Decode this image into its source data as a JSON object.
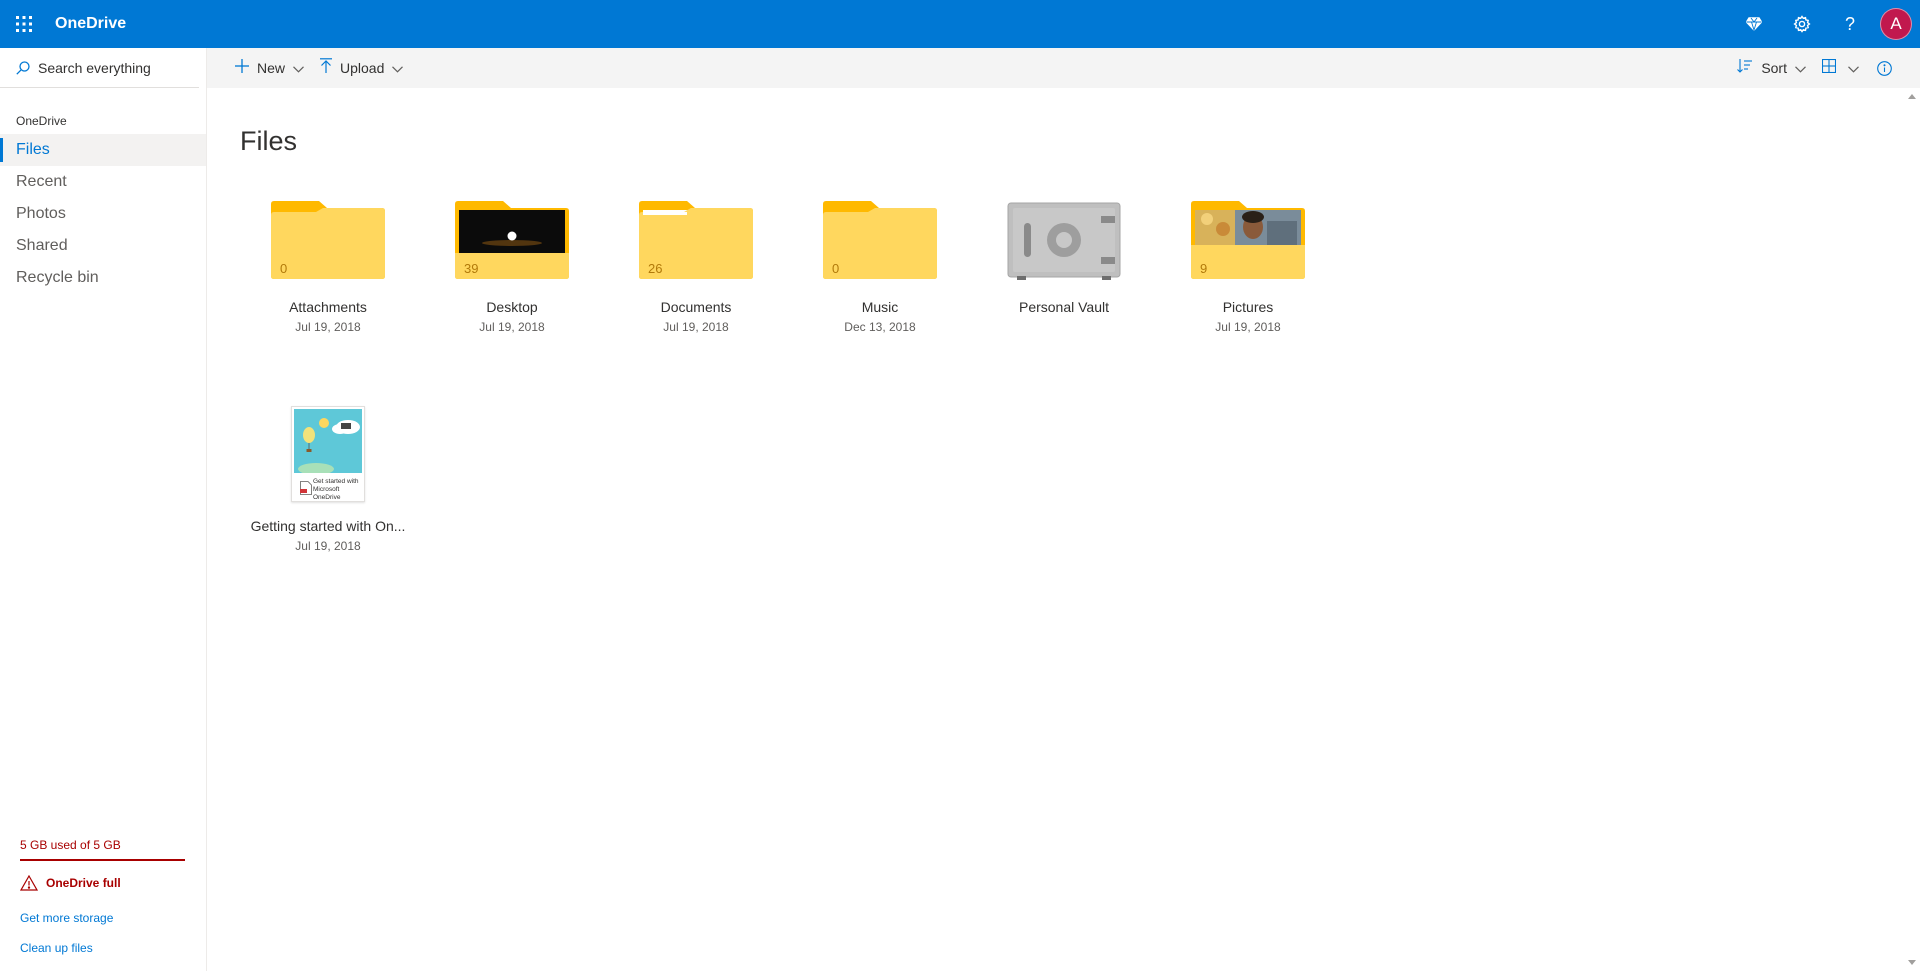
{
  "app": {
    "title": "OneDrive",
    "avatar_initial": "A",
    "accent": "#0078d4",
    "avatar_color": "#c1184e"
  },
  "topbar": {
    "icons": [
      "app-launcher-icon",
      "premium-diamond-icon",
      "settings-gear-icon",
      "help-icon"
    ]
  },
  "search": {
    "placeholder": "Search everything"
  },
  "sidebar": {
    "section": "OneDrive",
    "items": [
      {
        "label": "Files",
        "active": true
      },
      {
        "label": "Recent"
      },
      {
        "label": "Photos"
      },
      {
        "label": "Shared"
      },
      {
        "label": "Recycle bin"
      }
    ],
    "storage": {
      "usage_text": "5 GB used of 5 GB",
      "usage_fraction": 1.0,
      "full_label": "OneDrive full",
      "get_more": "Get more storage",
      "clean_up": "Clean up files"
    }
  },
  "commands": {
    "new": "New",
    "upload": "Upload",
    "sort": "Sort"
  },
  "main": {
    "title": "Files",
    "items": [
      {
        "name": "Attachments",
        "date": "Jul 19, 2018",
        "count": "0",
        "kind": "folder"
      },
      {
        "name": "Desktop",
        "date": "Jul 19, 2018",
        "count": "39",
        "kind": "folder-image"
      },
      {
        "name": "Documents",
        "date": "Jul 19, 2018",
        "count": "26",
        "kind": "folder"
      },
      {
        "name": "Music",
        "date": "Dec 13, 2018",
        "count": "0",
        "kind": "folder"
      },
      {
        "name": "Personal Vault",
        "date": "",
        "count": "",
        "kind": "vault"
      },
      {
        "name": "Pictures",
        "date": "Jul 19, 2018",
        "count": "9",
        "kind": "folder-image"
      },
      {
        "name": "Getting started with On...",
        "date": "Jul 19, 2018",
        "kind": "pdf",
        "thumb_text": "Get started with Microsoft OneDrive"
      }
    ]
  }
}
